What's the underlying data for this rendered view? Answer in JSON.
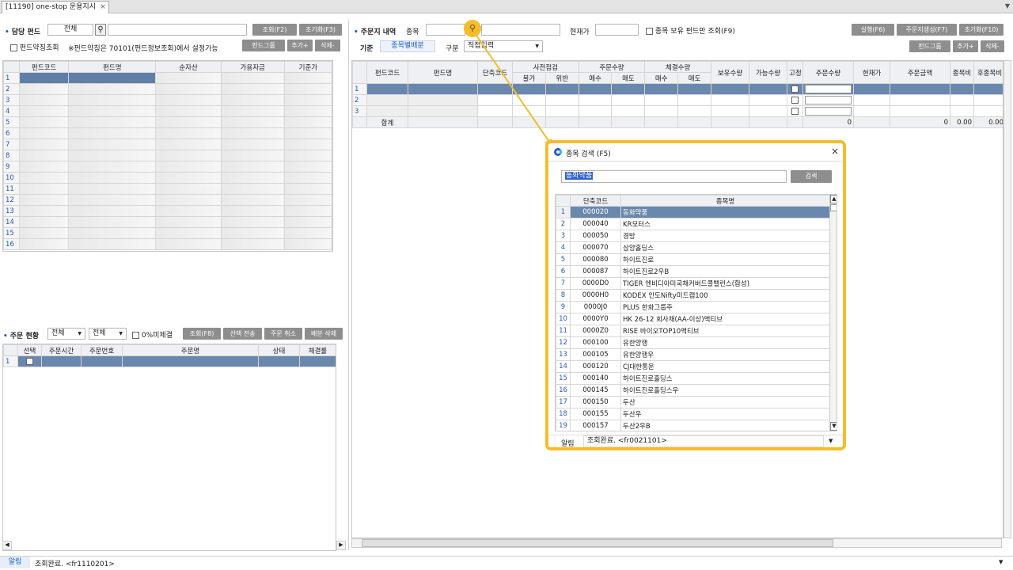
{
  "window": {
    "tab_title": "[11190] one-stop 운용지시",
    "tab_close": "×"
  },
  "left": {
    "fund_label": "담당 펀드",
    "fund_select": "전체",
    "btn_search": "조회(F2)",
    "btn_reset": "초기화(F3)",
    "chk_label": "펀드약칭조회",
    "note": "※펀드약칭은 70101(펀드정보조회)에서 설정가능",
    "btn_group": "펀드그룹",
    "btn_add": "추가+",
    "btn_del": "삭제-",
    "headers": [
      "펀드코드",
      "펀드명",
      "순자산",
      "가용자금",
      "기준가"
    ],
    "rows": [
      "1",
      "2",
      "3",
      "4",
      "5",
      "6",
      "7",
      "8",
      "9",
      "10",
      "11",
      "12",
      "13",
      "14",
      "15",
      "16"
    ]
  },
  "order_status": {
    "label": "주문 현황",
    "sel1": "전체",
    "sel2": "전체",
    "chk_label": "0%미체결",
    "btn_search": "조회(F8)",
    "btn_send": "선택 전송",
    "btn_cancel": "주문 취소",
    "btn_alloc": "배분 삭제",
    "headers": [
      "선택",
      "주문시간",
      "주문번호",
      "주문명",
      "상태",
      "체결률"
    ],
    "rows": [
      "1"
    ]
  },
  "right": {
    "label": "주문지 내역",
    "stock_label": "종목",
    "price_label": "현재가",
    "chk_label": "종목 보유 펀드만 조회(F9)",
    "btn_run": "실행(F6)",
    "btn_gen": "주문지생성(F7)",
    "btn_reset": "초기화(F10)",
    "basis_label": "기준",
    "basis_value": "종목별배분",
    "kind_label": "구분",
    "kind_value": "직접입력",
    "btn_group": "펀드그룹",
    "btn_add": "추가+",
    "btn_del": "삭제-",
    "headers": {
      "code": "펀드코드",
      "name": "펀드명",
      "short": "단축코드",
      "pre": "사전점검",
      "pre_no": "불가",
      "pre_viol": "위반",
      "order_qty": "주문수량",
      "buy": "매수",
      "sell": "매도",
      "fill_qty": "체결수량",
      "buy2": "매수",
      "sell2": "매도",
      "hold": "보유수량",
      "avail": "가능수량",
      "fix": "고정",
      "oqty": "주문수량",
      "cur": "현재가",
      "amt": "주문금액",
      "ratio": "종목비",
      "after": "후종목비"
    },
    "rows": [
      "1",
      "2",
      "3"
    ],
    "total": {
      "label": "합계",
      "qty": "0",
      "amt": "0",
      "ratio": "0.00",
      "after": "0.00"
    }
  },
  "dialog": {
    "title": "종목 검색 (F5)",
    "close": "×",
    "search_value": "동화약품",
    "search_btn": "검색",
    "headers": [
      "단축코드",
      "종목명"
    ],
    "rows": [
      {
        "no": "1",
        "code": "000020",
        "name": "동화약품"
      },
      {
        "no": "2",
        "code": "000040",
        "name": "KR모터스"
      },
      {
        "no": "3",
        "code": "000050",
        "name": "경방"
      },
      {
        "no": "4",
        "code": "000070",
        "name": "삼양홀딩스"
      },
      {
        "no": "5",
        "code": "000080",
        "name": "하이트진로"
      },
      {
        "no": "6",
        "code": "000087",
        "name": "하이트진로2우B"
      },
      {
        "no": "7",
        "code": "0000D0",
        "name": "TIGER 엔비디아미국채커버드콜밸런스(합성)"
      },
      {
        "no": "8",
        "code": "0000H0",
        "name": "KODEX 인도Nifty미드캡100"
      },
      {
        "no": "9",
        "code": "0000J0",
        "name": "PLUS 한화그룹주"
      },
      {
        "no": "10",
        "code": "0000Y0",
        "name": "HK 26-12 회사채(AA-이상)액티브"
      },
      {
        "no": "11",
        "code": "0000Z0",
        "name": "RISE 바이오TOP10액티브"
      },
      {
        "no": "12",
        "code": "000100",
        "name": "유한양행"
      },
      {
        "no": "13",
        "code": "000105",
        "name": "유한양행우"
      },
      {
        "no": "14",
        "code": "000120",
        "name": "CJ대한통운"
      },
      {
        "no": "15",
        "code": "000140",
        "name": "하이트진로홀딩스"
      },
      {
        "no": "16",
        "code": "000145",
        "name": "하이트진로홀딩스우"
      },
      {
        "no": "17",
        "code": "000150",
        "name": "두산"
      },
      {
        "no": "18",
        "code": "000155",
        "name": "두산우"
      },
      {
        "no": "19",
        "code": "000157",
        "name": "두산2우B"
      }
    ],
    "alert_label": "알림",
    "alert_text": "조회완료. <fr0021101>"
  },
  "status": {
    "label": "알림",
    "text": "조회완료. <fr1110201>"
  },
  "colors": {
    "highlight": "#f4bd2b",
    "selected_row": "#6a87ad",
    "accent": "#1a5fc8"
  }
}
